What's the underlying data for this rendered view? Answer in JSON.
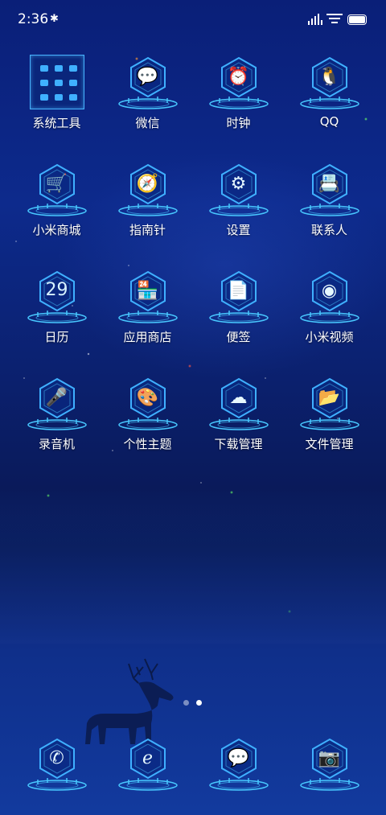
{
  "status_bar": {
    "time": "2:36"
  },
  "apps": [
    {
      "label": "系统工具",
      "icon": "folder-icon"
    },
    {
      "label": "微信",
      "icon": "wechat-icon"
    },
    {
      "label": "时钟",
      "icon": "alarm-clock-icon"
    },
    {
      "label": "QQ",
      "icon": "qq-penguin-icon"
    },
    {
      "label": "小米商城",
      "icon": "shopping-cart-icon"
    },
    {
      "label": "指南针",
      "icon": "compass-icon"
    },
    {
      "label": "设置",
      "icon": "gear-icon"
    },
    {
      "label": "联系人",
      "icon": "contact-book-icon"
    },
    {
      "label": "日历",
      "icon": "calendar-icon",
      "date": "29"
    },
    {
      "label": "应用商店",
      "icon": "store-icon"
    },
    {
      "label": "便签",
      "icon": "note-icon"
    },
    {
      "label": "小米视频",
      "icon": "video-reel-icon"
    },
    {
      "label": "录音机",
      "icon": "microphone-icon"
    },
    {
      "label": "个性主题",
      "icon": "palette-icon"
    },
    {
      "label": "下载管理",
      "icon": "cloud-download-icon"
    },
    {
      "label": "文件管理",
      "icon": "folder-open-icon"
    }
  ],
  "dock": [
    {
      "icon": "phone-icon"
    },
    {
      "icon": "browser-icon"
    },
    {
      "icon": "message-icon"
    },
    {
      "icon": "camera-icon"
    }
  ],
  "page_indicator": {
    "pages": 2,
    "current": 2
  },
  "colors": {
    "accent": "#3fb0ff",
    "glow": "#48c8ff"
  }
}
